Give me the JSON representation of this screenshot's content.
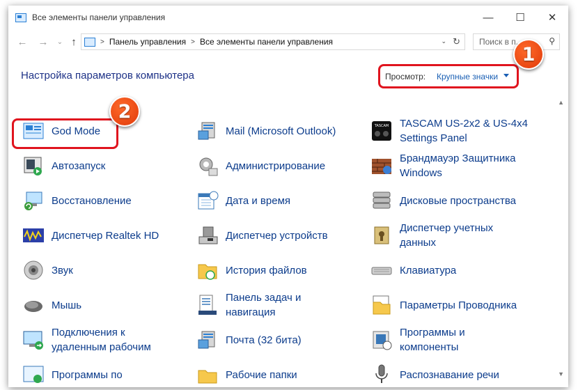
{
  "window": {
    "title": "Все элементы панели управления",
    "controls": {
      "minimize": "—",
      "maximize": "☐",
      "close": "✕"
    }
  },
  "address": {
    "back": "←",
    "forward": "→",
    "dropdown": "⌄",
    "up": "↑",
    "separator": ">",
    "crumbs": [
      "Панель управления",
      "Все элементы панели управления"
    ],
    "address_dropdown": "⌄",
    "refresh": "↻"
  },
  "search": {
    "placeholder": "Поиск в п...",
    "icon": "⚲"
  },
  "heading": "Настройка параметров компьютера",
  "view": {
    "label": "Просмотр:",
    "value": "Крупные значки"
  },
  "scroll": {
    "up": "▲",
    "down": "▼"
  },
  "badges": [
    "1",
    "2"
  ],
  "columns": [
    [
      {
        "label": [
          "God Mode"
        ],
        "icon": "god-mode-icon"
      },
      {
        "label": [
          "Автозапуск"
        ],
        "icon": "autoplay-icon"
      },
      {
        "label": [
          "Восстановление"
        ],
        "icon": "recovery-icon"
      },
      {
        "label": [
          "Диспетчер Realtek HD"
        ],
        "icon": "realtek-audio-icon"
      },
      {
        "label": [
          "Звук"
        ],
        "icon": "speaker-icon"
      },
      {
        "label": [
          "Мышь"
        ],
        "icon": "mouse-icon"
      },
      {
        "label": [
          "Подключения к",
          "удаленным рабочим"
        ],
        "icon": "remote-desktop-icon"
      },
      {
        "label": [
          "Программы по"
        ],
        "icon": "default-programs-icon"
      }
    ],
    [
      {
        "label": [
          "Mail (Microsoft Outlook)"
        ],
        "icon": "mail-icon"
      },
      {
        "label": [
          "Администрирование"
        ],
        "icon": "admin-tools-icon"
      },
      {
        "label": [
          "Дата и время"
        ],
        "icon": "calendar-clock-icon"
      },
      {
        "label": [
          "Диспетчер устройств"
        ],
        "icon": "device-manager-icon"
      },
      {
        "label": [
          "История файлов"
        ],
        "icon": "file-history-icon"
      },
      {
        "label": [
          "Панель задач и",
          "навигация"
        ],
        "icon": "taskbar-icon"
      },
      {
        "label": [
          "Почта (32 бита)"
        ],
        "icon": "mail-32-icon"
      },
      {
        "label": [
          "Рабочие папки"
        ],
        "icon": "work-folders-icon"
      }
    ],
    [
      {
        "label": [
          "TASCAM US-2x2 & US-4x4",
          " Settings Panel"
        ],
        "icon": "tascam-icon"
      },
      {
        "label": [
          "Брандмауэр Защитника",
          "Windows"
        ],
        "icon": "firewall-icon"
      },
      {
        "label": [
          "Дисковые пространства"
        ],
        "icon": "storage-spaces-icon"
      },
      {
        "label": [
          "Диспетчер учетных",
          "данных"
        ],
        "icon": "credential-manager-icon"
      },
      {
        "label": [
          "Клавиатура"
        ],
        "icon": "keyboard-icon"
      },
      {
        "label": [
          "Параметры Проводника"
        ],
        "icon": "explorer-options-icon"
      },
      {
        "label": [
          "Программы и",
          "компоненты"
        ],
        "icon": "programs-features-icon"
      },
      {
        "label": [
          "Распознавание речи"
        ],
        "icon": "microphone-icon"
      }
    ]
  ]
}
